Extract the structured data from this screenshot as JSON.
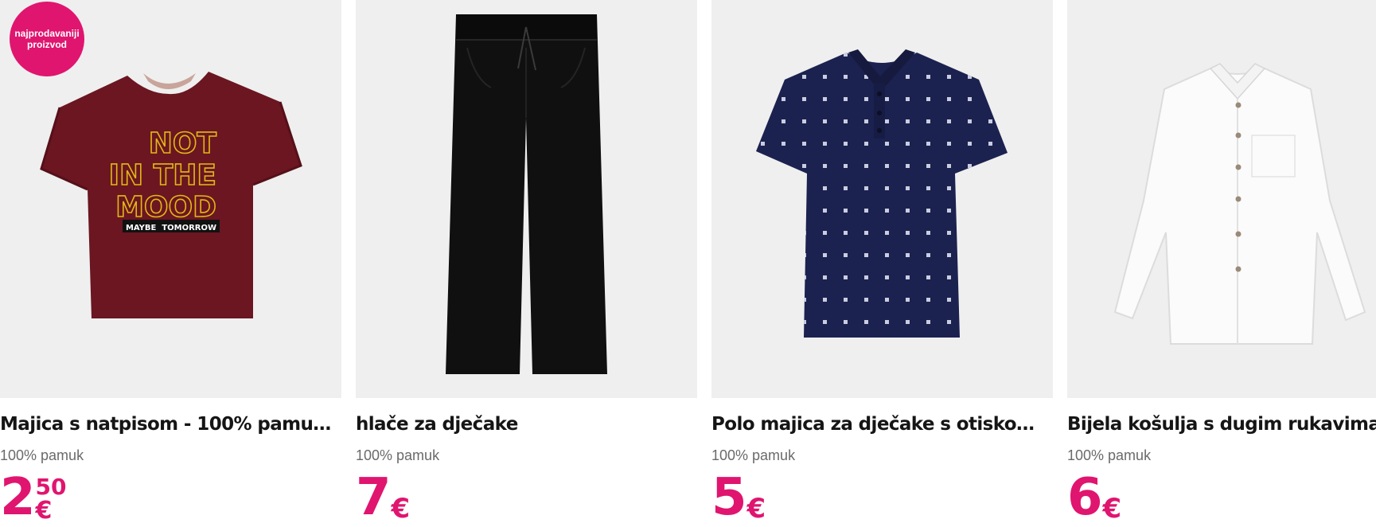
{
  "accent_color": "#e0156f",
  "badge": {
    "label": "najprodavaniji proizvod"
  },
  "products": [
    {
      "title": "Majica s natpisom - 100% pamuk ...",
      "subtitle": "100% pamuk",
      "price_main": "2",
      "price_cents": "50",
      "currency": "€",
      "image_icon": "tshirt-icon",
      "print_lines": [
        "NOT",
        "IN THE",
        "MOOD"
      ],
      "print_tag": "MAYBE  TOMORROW"
    },
    {
      "title": "hlače za dječake",
      "subtitle": "100% pamuk",
      "price_main": "7",
      "price_cents": "",
      "currency": "€",
      "image_icon": "trousers-icon"
    },
    {
      "title": "Polo majica za dječake s otiskom...",
      "subtitle": "100% pamuk",
      "price_main": "5",
      "price_cents": "",
      "currency": "€",
      "image_icon": "polo-shirt-icon"
    },
    {
      "title": "Bijela košulja s dugim rukavima...",
      "subtitle": "100% pamuk",
      "price_main": "6",
      "price_cents": "",
      "currency": "€",
      "image_icon": "shirt-icon"
    }
  ]
}
